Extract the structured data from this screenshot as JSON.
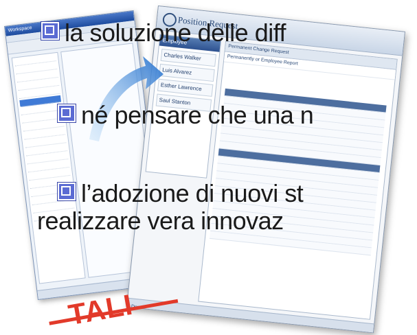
{
  "bullets": [
    {
      "text": "la soluzione delle diff"
    },
    {
      "text": "né pensare che una n"
    },
    {
      "text_line1": "l’adozione di nuovi st",
      "text_line2": "realizzare vera innovaz"
    }
  ],
  "screenshot_right": {
    "header_title": "Position Request",
    "sidebar_header": "Employee",
    "sidebar_items": [
      "Charles Walker",
      "Luis Alvarez",
      "Esther Lawrence",
      "Saul Stanton"
    ],
    "form_header": "Permanent Change Request",
    "form_subheader": "Permanently  or  Employee  Report",
    "status": "Done"
  },
  "screenshot_left": {
    "title": "Workspace"
  },
  "stamp": {
    "text": "TALI"
  },
  "colors": {
    "bullet_square": "#5b6bd3",
    "stamp": "#e23a2a",
    "arrow": "#3f86d6"
  },
  "icons": [
    "checkbox-square-icon",
    "arrow-icon"
  ]
}
